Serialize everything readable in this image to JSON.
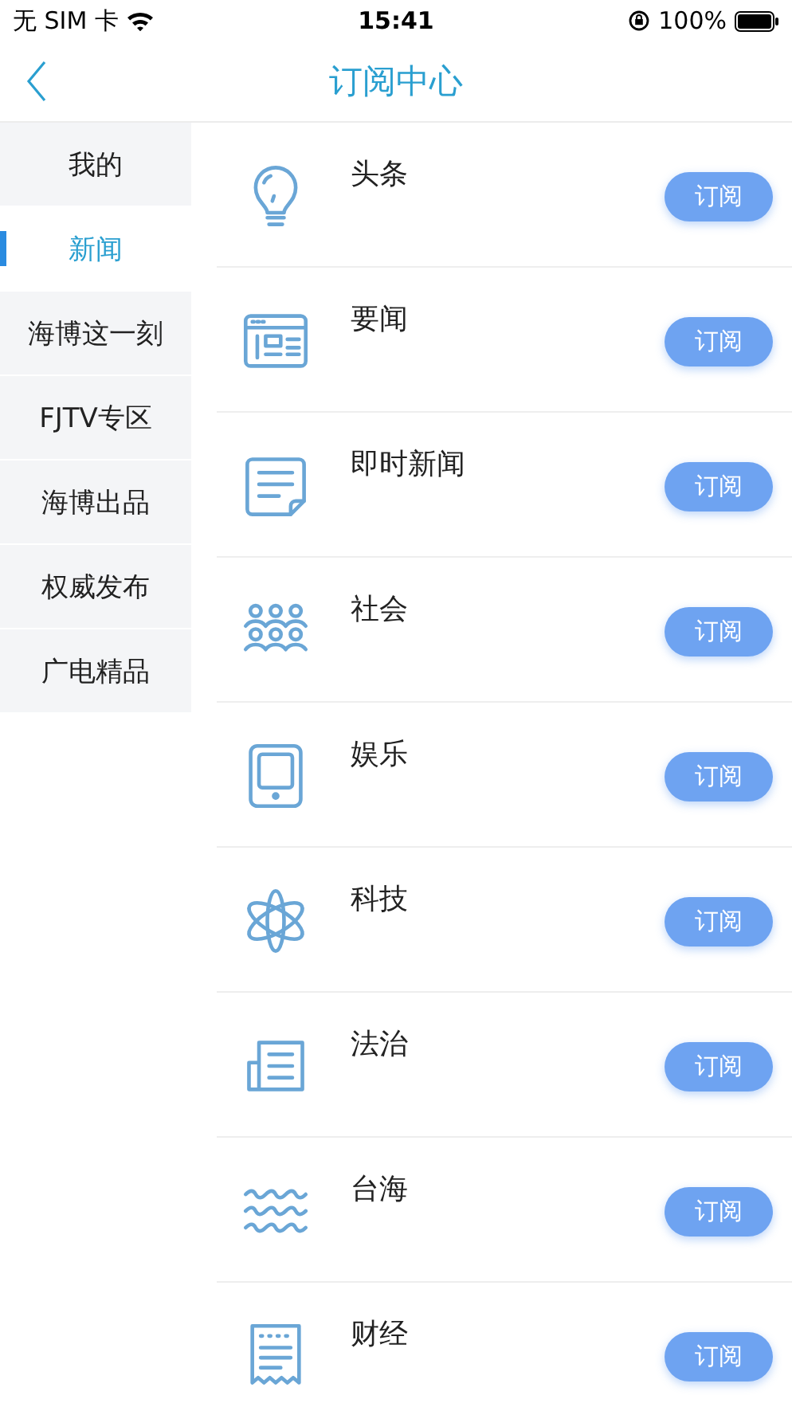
{
  "status_bar": {
    "carrier": "无 SIM 卡",
    "time": "15:41",
    "battery": "100%"
  },
  "nav": {
    "title": "订阅中心"
  },
  "sidebar": {
    "items": [
      {
        "label": "我的",
        "selected": false
      },
      {
        "label": "新闻",
        "selected": true
      },
      {
        "label": "海博这一刻",
        "selected": false
      },
      {
        "label": "FJTV专区",
        "selected": false
      },
      {
        "label": "海博出品",
        "selected": false
      },
      {
        "label": "权威发布",
        "selected": false
      },
      {
        "label": "广电精品",
        "selected": false
      }
    ]
  },
  "channels": [
    {
      "name": "头条",
      "button": "订阅"
    },
    {
      "name": "要闻",
      "button": "订阅"
    },
    {
      "name": "即时新闻",
      "button": "订阅"
    },
    {
      "name": "社会",
      "button": "订阅"
    },
    {
      "name": "娱乐",
      "button": "订阅"
    },
    {
      "name": "科技",
      "button": "订阅"
    },
    {
      "name": "法治",
      "button": "订阅"
    },
    {
      "name": "台海",
      "button": "订阅"
    },
    {
      "name": "财经",
      "button": "订阅"
    }
  ]
}
